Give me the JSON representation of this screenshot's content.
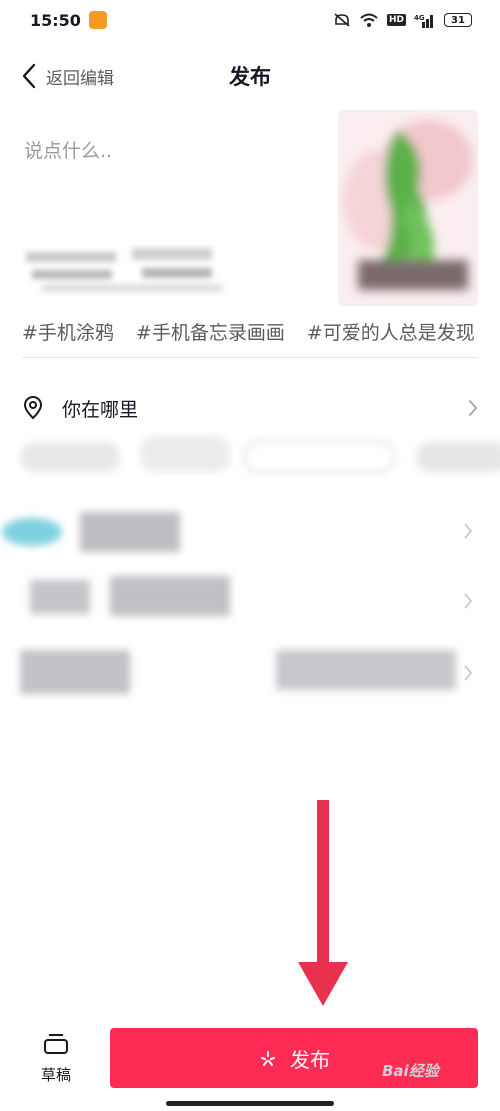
{
  "status_bar": {
    "time": "15:50",
    "network": "HD",
    "signal_label": "4G",
    "battery": "31"
  },
  "nav": {
    "back_label": "返回编辑",
    "title": "发布"
  },
  "post": {
    "caption_placeholder": "说点什么..",
    "tags": [
      "#手机涂鸦",
      "#手机备忘录画画",
      "#可爱的人总是发现"
    ]
  },
  "location": {
    "label": "你在哪里"
  },
  "bottom": {
    "draft_label": "草稿",
    "publish_label": "发布"
  },
  "watermark": "Bai经验",
  "colors": {
    "accent": "#fe2c55",
    "arrow": "#e8314f"
  }
}
